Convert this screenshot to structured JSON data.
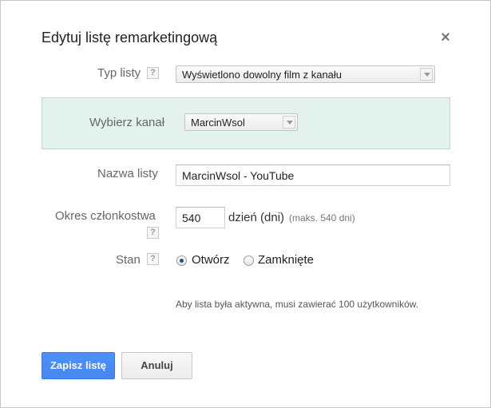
{
  "dialog": {
    "title": "Edytuj listę remarketingową",
    "close_icon": "×"
  },
  "list_type": {
    "label": "Typ listy",
    "help": "?",
    "value": "Wyświetlono dowolny film z kanału"
  },
  "channel": {
    "label": "Wybierz kanał",
    "value": "MarcinWsol"
  },
  "list_name": {
    "label": "Nazwa listy",
    "value": "MarcinWsol - YouTube"
  },
  "membership": {
    "label": "Okres członkostwa",
    "help": "?",
    "value": "540",
    "unit": "dzień (dni)",
    "hint": "(maks. 540 dni)"
  },
  "status": {
    "label": "Stan",
    "help": "?",
    "options": [
      {
        "label": "Otwórz",
        "checked": true
      },
      {
        "label": "Zamknięte",
        "checked": false
      }
    ]
  },
  "note": "Aby lista była aktywna, musi zawierać 100 użytkowników.",
  "buttons": {
    "save": "Zapisz listę",
    "cancel": "Anuluj"
  },
  "colors": {
    "primary_button": "#4d90fe",
    "channel_panel_bg": "#e3f2ec"
  }
}
